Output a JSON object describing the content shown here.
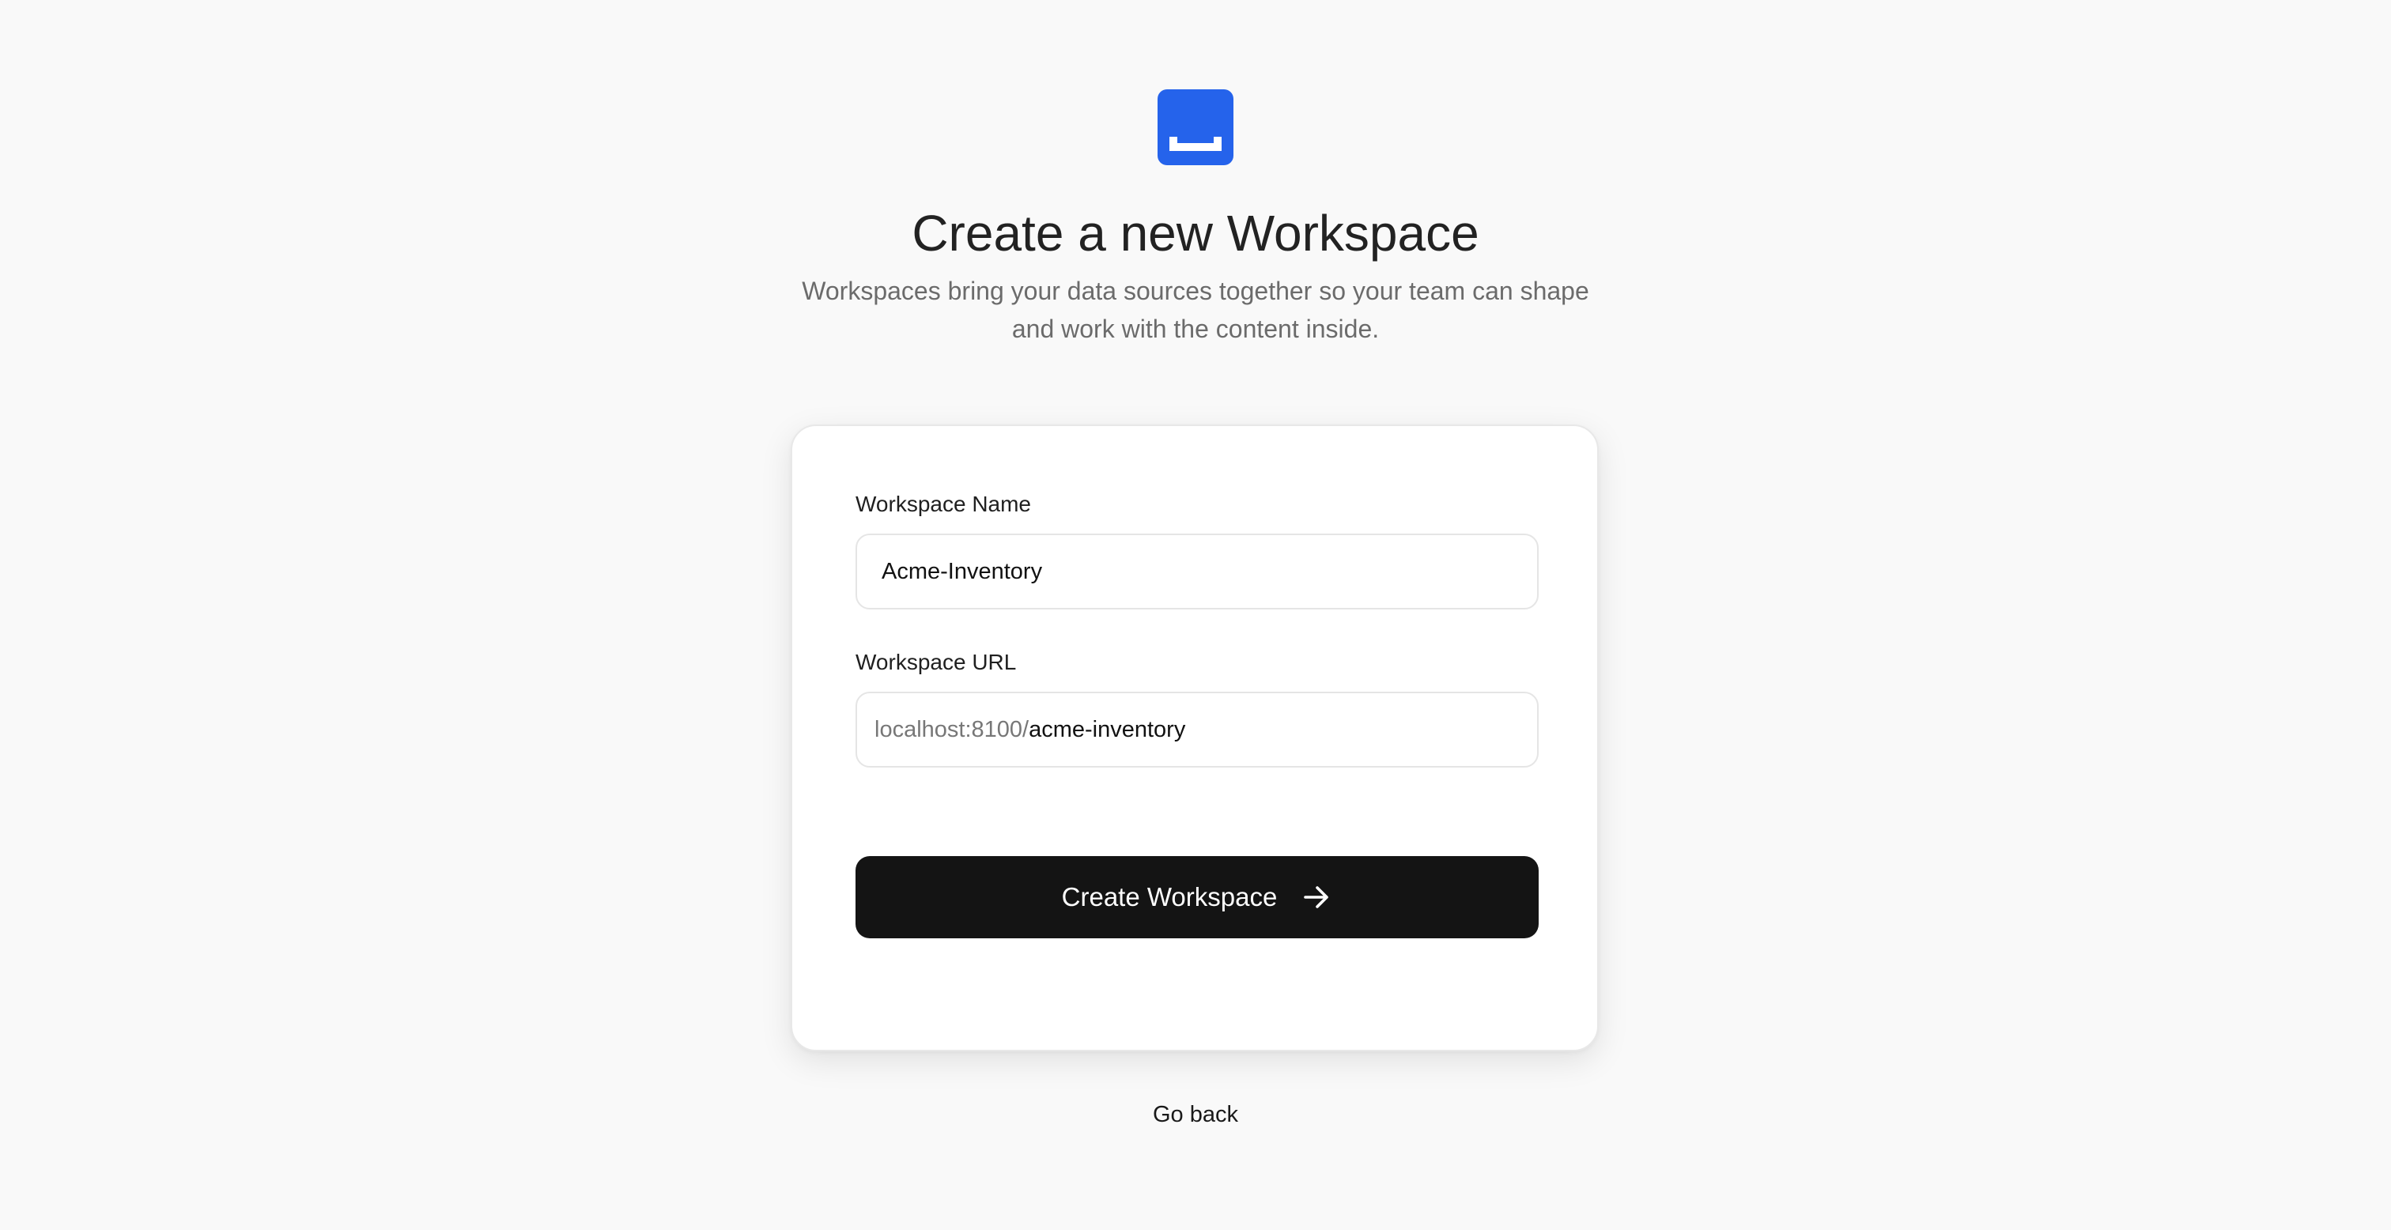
{
  "brand": {
    "logo_icon": "inbox-tray-icon",
    "accent_color": "#2563eb"
  },
  "header": {
    "title": "Create a new Workspace",
    "subtitle": "Workspaces bring your data sources together so your team can shape and work with the content inside."
  },
  "form": {
    "name_label": "Workspace Name",
    "name_value": "Acme-Inventory",
    "url_label": "Workspace URL",
    "url_prefix": "localhost:8100/",
    "url_value": "acme-inventory",
    "submit_label": "Create Workspace",
    "submit_icon": "arrow-right-icon"
  },
  "footer": {
    "back_label": "Go back"
  }
}
